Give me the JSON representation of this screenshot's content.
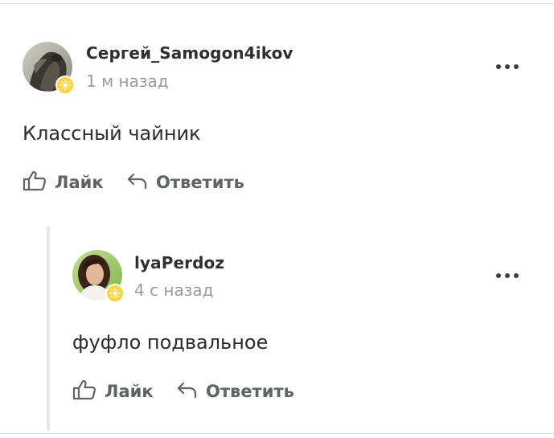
{
  "comments": [
    {
      "author": "Сергей_Samogon4ikov",
      "time": "1 м назад",
      "text": "Классный чайник",
      "like_label": "Лайк",
      "reply_label": "Ответить",
      "more_icon": "more-horizontal-icon",
      "badge_icon": "sun-badge-icon"
    },
    {
      "author": "lyaPerdoz",
      "time": "4 с назад",
      "text": "фуфло подвальное",
      "like_label": "Лайк",
      "reply_label": "Ответить",
      "more_icon": "more-horizontal-icon",
      "badge_icon": "sun-badge-icon"
    }
  ],
  "colors": {
    "author": "#2f2f2f",
    "time": "#9a9a9a",
    "action": "#5f6266",
    "badge": "#ffd33b",
    "thread_line": "#e6e6e6"
  }
}
